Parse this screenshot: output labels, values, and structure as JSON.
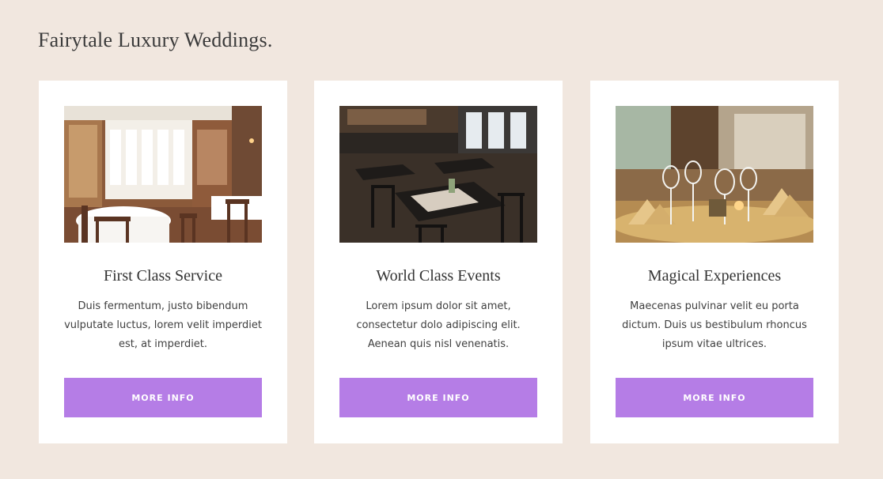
{
  "page": {
    "heading": "Fairytale Luxury Weddings."
  },
  "colors": {
    "background": "#f1e7df",
    "card": "#ffffff",
    "accent_button": "#b57de6",
    "heading_text": "#3a3a3a"
  },
  "cards": [
    {
      "image_subject": "bright restaurant dining room with white tablecloths and wooden chairs",
      "title": "First Class Service",
      "text": "Duis fermentum, justo bibendum vulputate luctus, lorem velit imperdiet est, at imperdiet.",
      "button_label": "MORE INFO"
    },
    {
      "image_subject": "dark restaurant interior with black tables and chairs",
      "title": "World Class Events",
      "text": "Lorem ipsum dolor sit amet, consectetur dolo adipiscing elit. Aenean quis nisl venenatis.",
      "button_label": "MORE INFO"
    },
    {
      "image_subject": "close-up of wine glasses and folded napkins on a set table",
      "title": "Magical Experiences",
      "text": "Maecenas pulvinar velit eu porta dictum. Duis us bestibulum rhoncus ipsum vitae ultrices.",
      "button_label": "MORE INFO"
    }
  ]
}
